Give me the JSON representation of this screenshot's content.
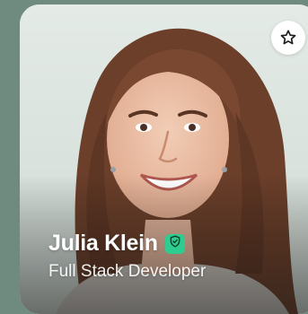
{
  "profile": {
    "name": "Julia Klein",
    "role": "Full Stack Developer",
    "verified_icon": "shield-check-icon",
    "favorite_icon": "star-outline-icon"
  },
  "colors": {
    "badge": "#2ecc8e",
    "text": "#ffffff",
    "card_background": "#dfe6e2",
    "page_background": "#6f8a7e"
  }
}
